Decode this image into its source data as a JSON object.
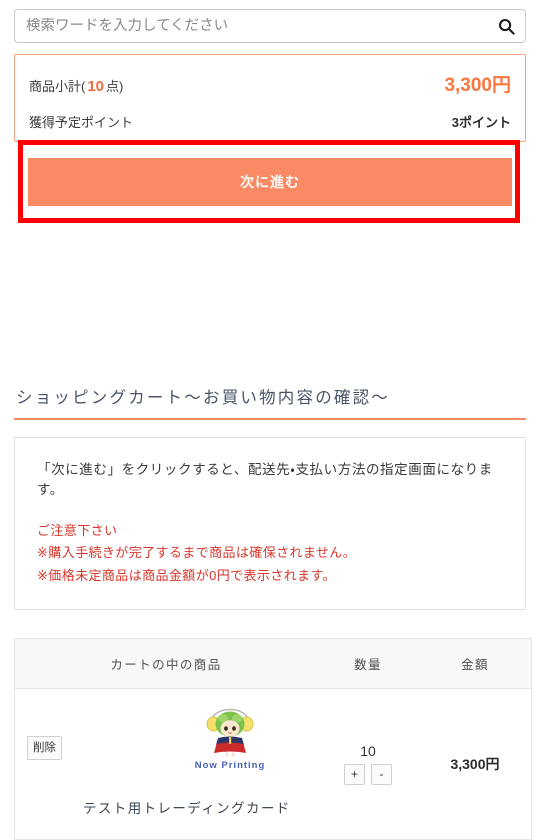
{
  "search": {
    "placeholder": "検索ワードを入力してください",
    "value": "",
    "icon": "search-icon"
  },
  "summary": {
    "subtotal_label_prefix": "商品小計(",
    "subtotal_count": "10",
    "subtotal_label_suffix": "点)",
    "subtotal_amount": "3,300円",
    "points_label": "獲得予定ポイント",
    "points_value": "3ポイント",
    "accent_color": "#f9773f",
    "border_color": "#f0a07c"
  },
  "next_button": {
    "label": "次に進む",
    "color": "#fa8a63",
    "annotation_color": "#fe0000"
  },
  "section": {
    "title": "ショッピングカート〜お買い物内容の確認〜",
    "rule_color": "#f48c5e"
  },
  "notice": {
    "main": "「次に進む」をクリックすると、配送先・支払い方法の指定画面になります。",
    "warnings": [
      "ご注意下さい",
      "※購入手続きが完了するまで商品は確保されません。",
      "※価格未定商品は商品金額が0円で表示されます。"
    ],
    "warning_color": "#d9362b"
  },
  "cart": {
    "headers": {
      "item": "カートの中の商品",
      "quantity": "数量",
      "amount": "金額"
    },
    "rows": [
      {
        "delete_label": "削除",
        "thumbnail_caption": "Now Printing",
        "thumbnail_icon": "now-printing-placeholder-icon",
        "name": "テスト用トレーディングカード",
        "quantity": "10",
        "increment_label": "+",
        "decrement_label": "-",
        "amount": "3,300円"
      }
    ]
  }
}
